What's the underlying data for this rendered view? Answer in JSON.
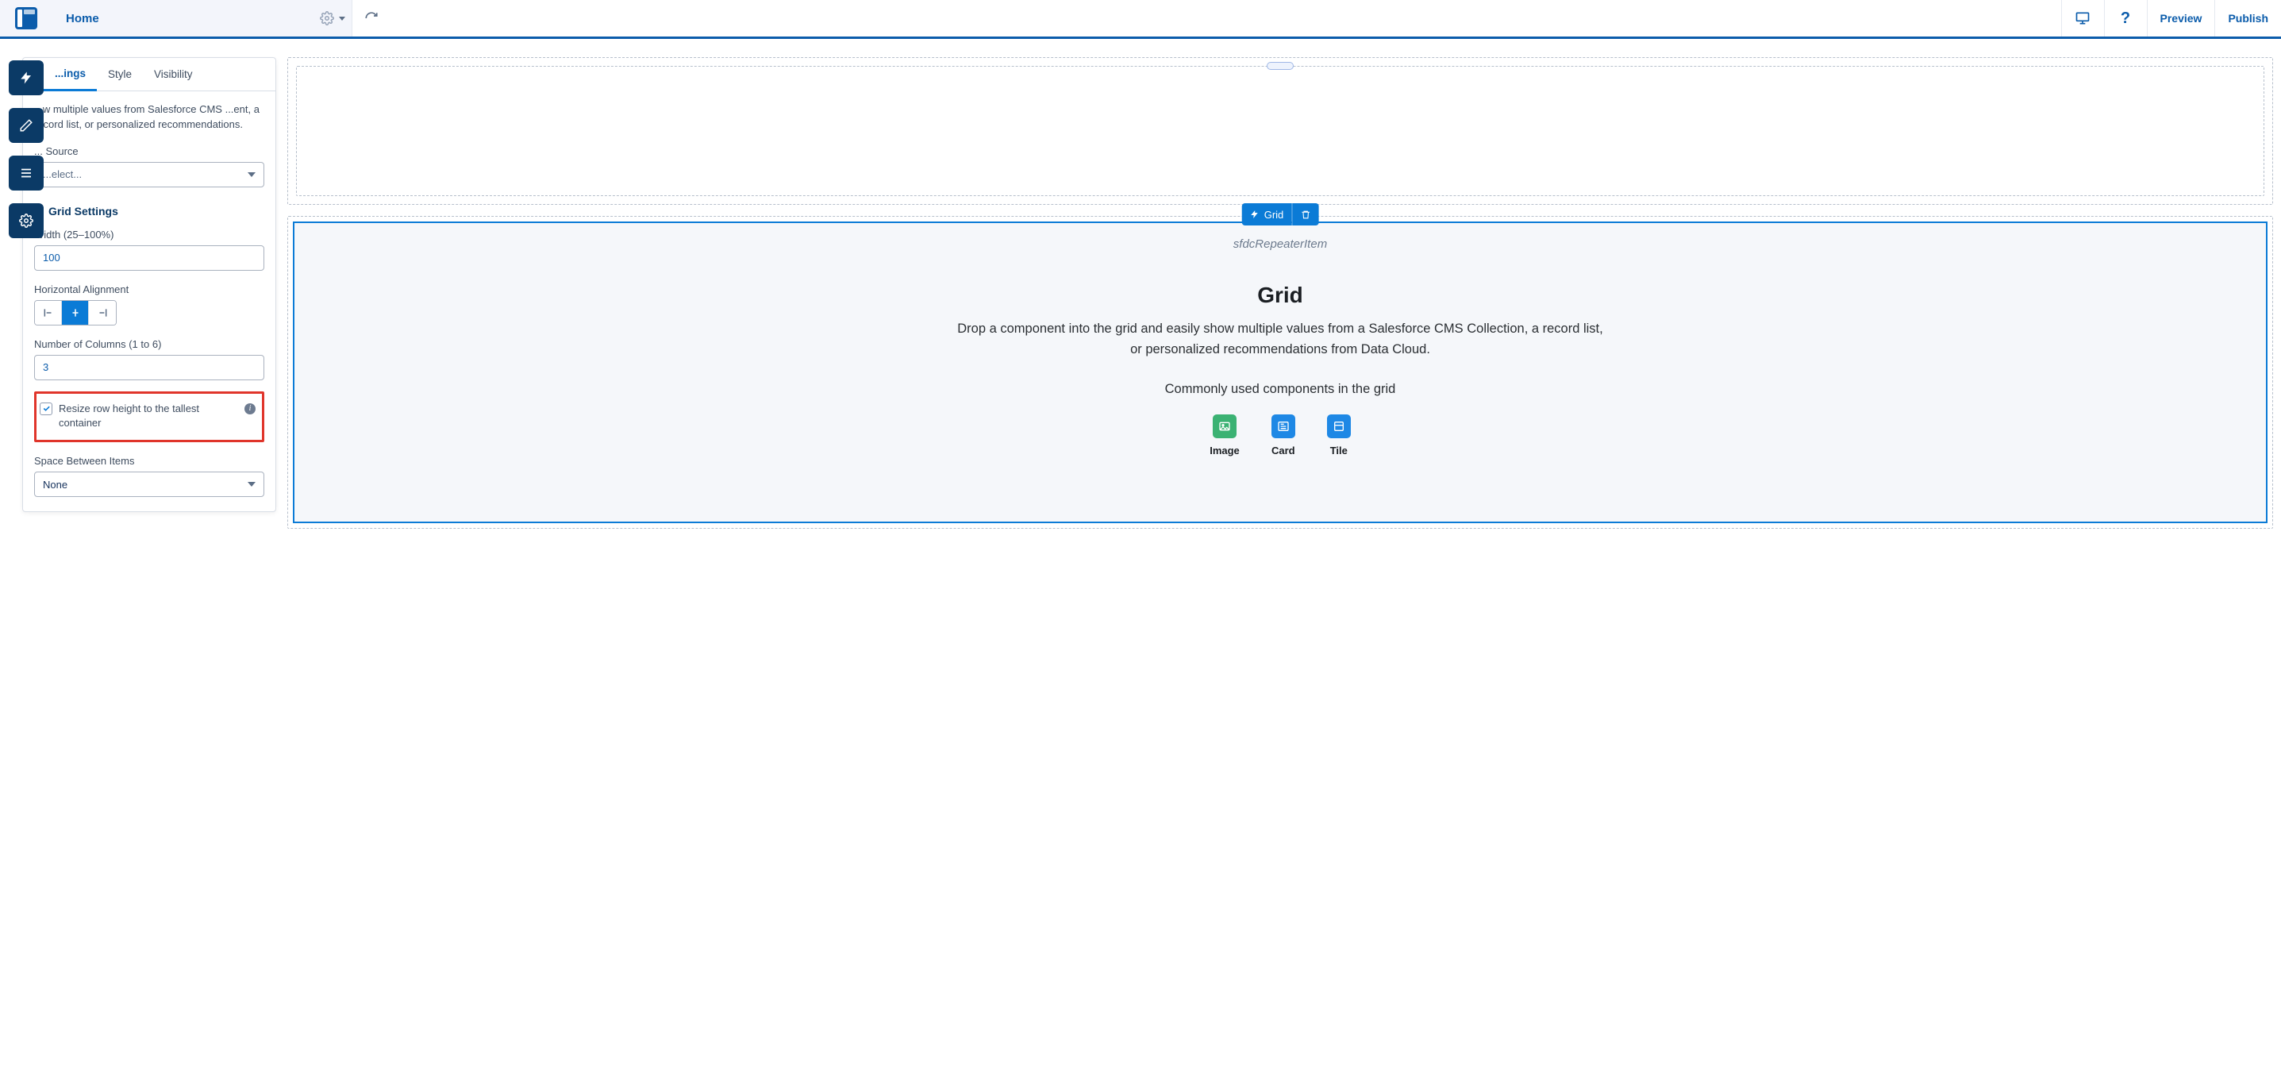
{
  "topbar": {
    "page_title": "Home",
    "preview_label": "Preview",
    "publish_label": "Publish"
  },
  "panel": {
    "tabs": {
      "settings": "...ings",
      "style": "Style",
      "visibility": "Visibility"
    },
    "description": "...w multiple values from Salesforce CMS ...ent, a record list, or personalized recommendations.",
    "data_source_label": "... Source",
    "data_source_placeholder": "...elect...",
    "section_grid_settings": "Grid Settings",
    "width_label": "Width (25–100%)",
    "width_value": "100",
    "horiz_align_label": "Horizontal Alignment",
    "num_columns_label": "Number of Columns (1 to 6)",
    "num_columns_value": "3",
    "resize_checkbox_label": "Resize row height to the tallest container",
    "resize_checked": true,
    "space_between_label": "Space Between Items",
    "space_between_value": "None"
  },
  "canvas": {
    "grid_toolbar_label": "Grid",
    "repeater_label": "sfdcRepeaterItem",
    "grid_title": "Grid",
    "grid_description": "Drop a component into the grid and easily show multiple values from a Salesforce CMS Collection, a record list, or personalized recommendations from Data Cloud.",
    "grid_subtitle": "Commonly used components in the grid",
    "components": [
      {
        "label": "Image",
        "icon": "image-icon",
        "color": "green"
      },
      {
        "label": "Card",
        "icon": "card-icon",
        "color": "blue"
      },
      {
        "label": "Tile",
        "icon": "tile-icon",
        "color": "blue"
      }
    ]
  }
}
